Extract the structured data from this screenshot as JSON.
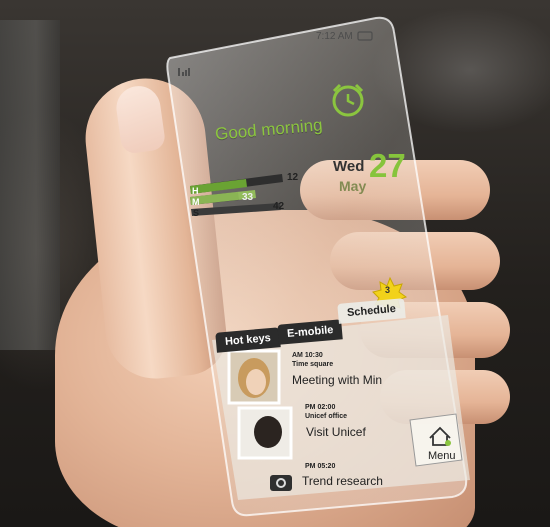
{
  "status_bar": {
    "time": "7:12 AM"
  },
  "greeting": "Good morning",
  "date": {
    "weekday": "Wed",
    "month": "May",
    "day": "27"
  },
  "meters": [
    {
      "label": "H",
      "value": "12"
    },
    {
      "label": "M",
      "value": "33"
    },
    {
      "label": "S",
      "value": "42"
    }
  ],
  "tabs": [
    "Hot keys",
    "E-mobile",
    "Schedule"
  ],
  "schedule_badge": "3",
  "schedule": [
    {
      "time": "AM 10:30",
      "place": "Time square",
      "title": "Meeting with Min"
    },
    {
      "time": "PM 02:00",
      "place": "Unicef office",
      "title": "Visit Unicef"
    },
    {
      "time": "PM 05:20",
      "place": "",
      "title": "Trend research"
    }
  ],
  "menu_label": "Menu",
  "colors": {
    "accent_green": "#8bc53f",
    "tab_dark": "#2b2b2b"
  }
}
